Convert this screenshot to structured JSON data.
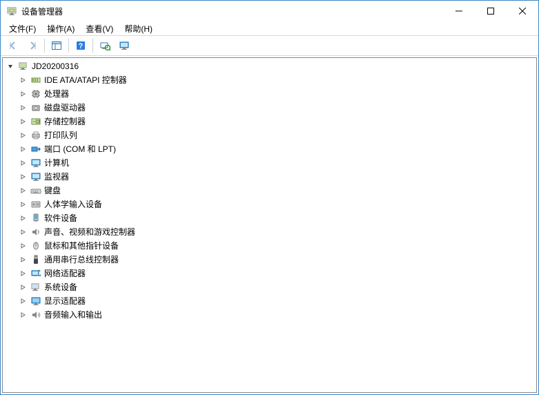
{
  "window": {
    "title": "设备管理器"
  },
  "menubar": {
    "file": "文件(F)",
    "action": "操作(A)",
    "view": "查看(V)",
    "help": "帮助(H)"
  },
  "tree": {
    "root": {
      "label": "JD20200316",
      "icon": "computer",
      "expanded": true
    },
    "categories": [
      {
        "label": "IDE ATA/ATAPI 控制器",
        "icon": "ide"
      },
      {
        "label": "处理器",
        "icon": "cpu"
      },
      {
        "label": "磁盘驱动器",
        "icon": "disk"
      },
      {
        "label": "存储控制器",
        "icon": "storage"
      },
      {
        "label": "打印队列",
        "icon": "printer"
      },
      {
        "label": "端口 (COM 和 LPT)",
        "icon": "port"
      },
      {
        "label": "计算机",
        "icon": "monitor"
      },
      {
        "label": "监视器",
        "icon": "monitor"
      },
      {
        "label": "键盘",
        "icon": "keyboard"
      },
      {
        "label": "人体学输入设备",
        "icon": "hid"
      },
      {
        "label": "软件设备",
        "icon": "software"
      },
      {
        "label": "声音、视频和游戏控制器",
        "icon": "sound"
      },
      {
        "label": "鼠标和其他指针设备",
        "icon": "mouse"
      },
      {
        "label": "通用串行总线控制器",
        "icon": "usb"
      },
      {
        "label": "网络适配器",
        "icon": "network"
      },
      {
        "label": "系统设备",
        "icon": "system"
      },
      {
        "label": "显示适配器",
        "icon": "display"
      },
      {
        "label": "音频输入和输出",
        "icon": "audio"
      }
    ]
  }
}
